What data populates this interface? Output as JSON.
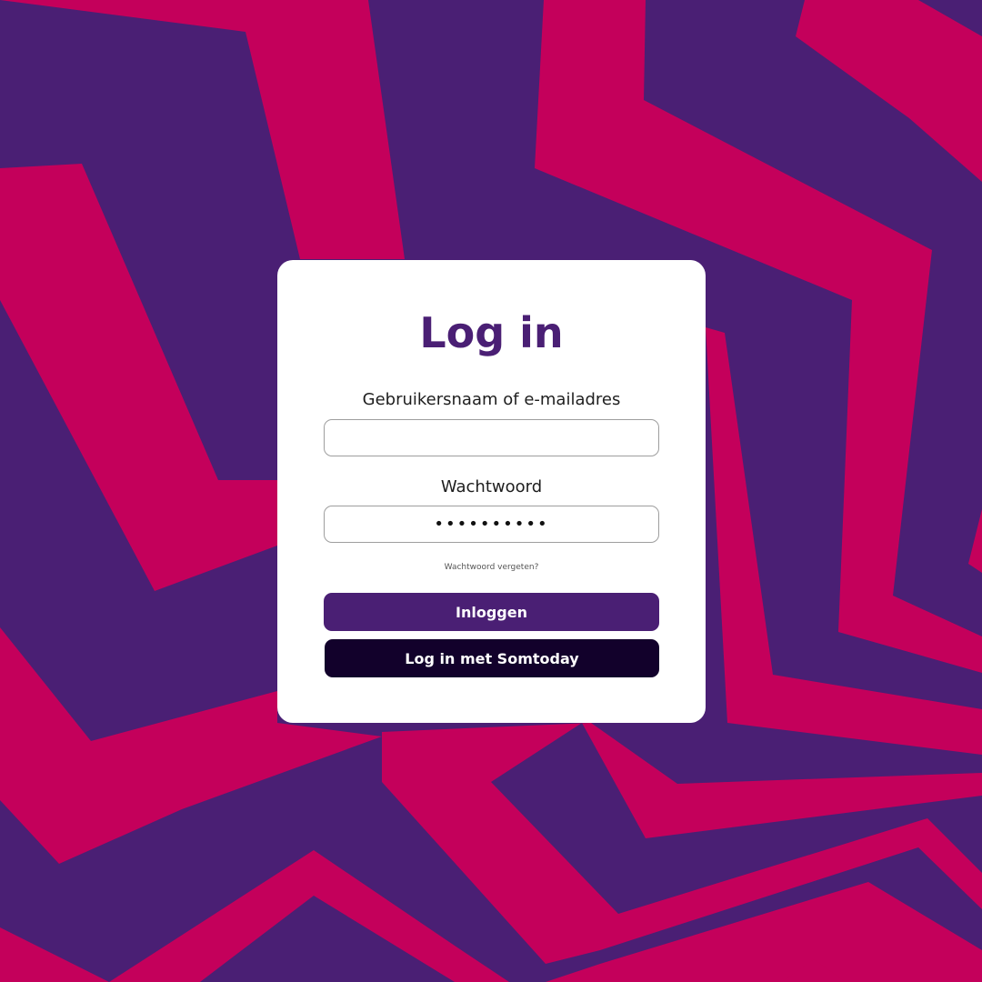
{
  "colors": {
    "background_purple": "#4a1f74",
    "background_magenta": "#c4005b",
    "accent": "#4a1f74",
    "dark_button": "#12012b"
  },
  "login": {
    "title": "Log in",
    "username_label": "Gebruikersnaam of e-mailadres",
    "username_value": "",
    "password_label": "Wachtwoord",
    "password_value": "••••••••••",
    "forgot_password": "Wachtwoord vergeten?",
    "login_button": "Inloggen",
    "somtoday_button": "Log in met Somtoday"
  }
}
